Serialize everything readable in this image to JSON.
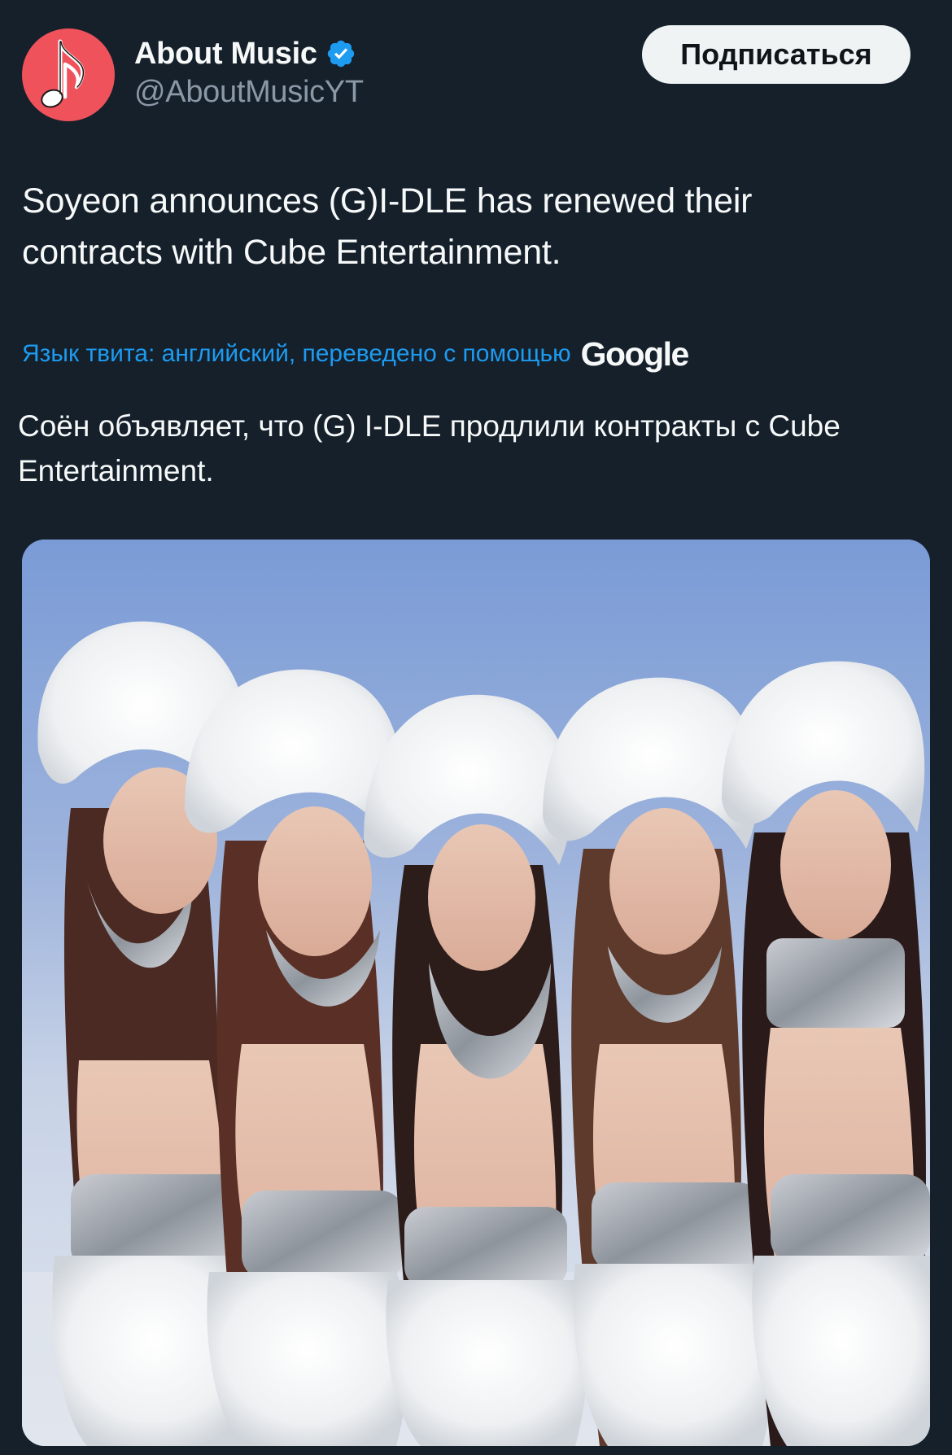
{
  "author": {
    "name": "About Music",
    "handle": "@AboutMusicYT",
    "verified": true,
    "avatar_icon": "music-note-icon",
    "avatar_color": "#f0525b"
  },
  "follow_button": {
    "label": "Подписаться"
  },
  "tweet": {
    "text": "Soyeon announces (G)I-DLE has renewed their contracts with Cube Entertainment."
  },
  "translation": {
    "note": "Язык твита: английский, переведено с помощью",
    "provider": "Google",
    "text": "Соён объявляет, что (G) I-DLE продлили контракты с Cube Entertainment."
  },
  "colors": {
    "background": "#15202b",
    "link": "#1d9bf0",
    "verified": "#1d9bf0",
    "secondary_text": "#8b98a5"
  }
}
